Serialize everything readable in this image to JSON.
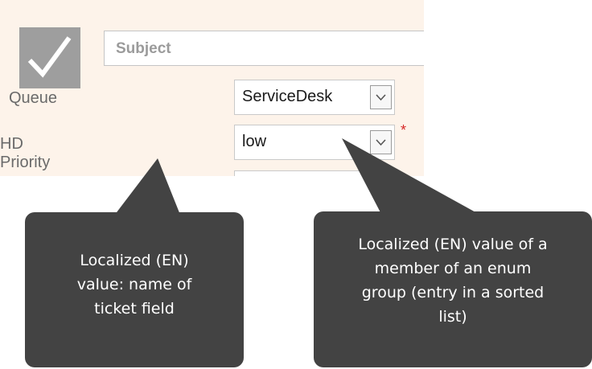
{
  "form": {
    "subject_placeholder": "Subject",
    "queue_label": "Queue",
    "queue_value": "ServiceDesk",
    "priority_label": "HD Priority",
    "priority_value": "low",
    "required_mark": "*"
  },
  "icons": {
    "checkbox": "checkmark-icon",
    "dropdown": "chevron-down-icon"
  },
  "callouts": {
    "left_text": "Localized (EN)\nvalue: name of\nticket field",
    "right_text": "Localized (EN) value of a\nmember of an enum\ngroup (entry in a sorted\nlist)"
  },
  "colors": {
    "panel_background": "#fdf3ea",
    "callout_background": "#434343",
    "required_mark": "#d62828"
  }
}
